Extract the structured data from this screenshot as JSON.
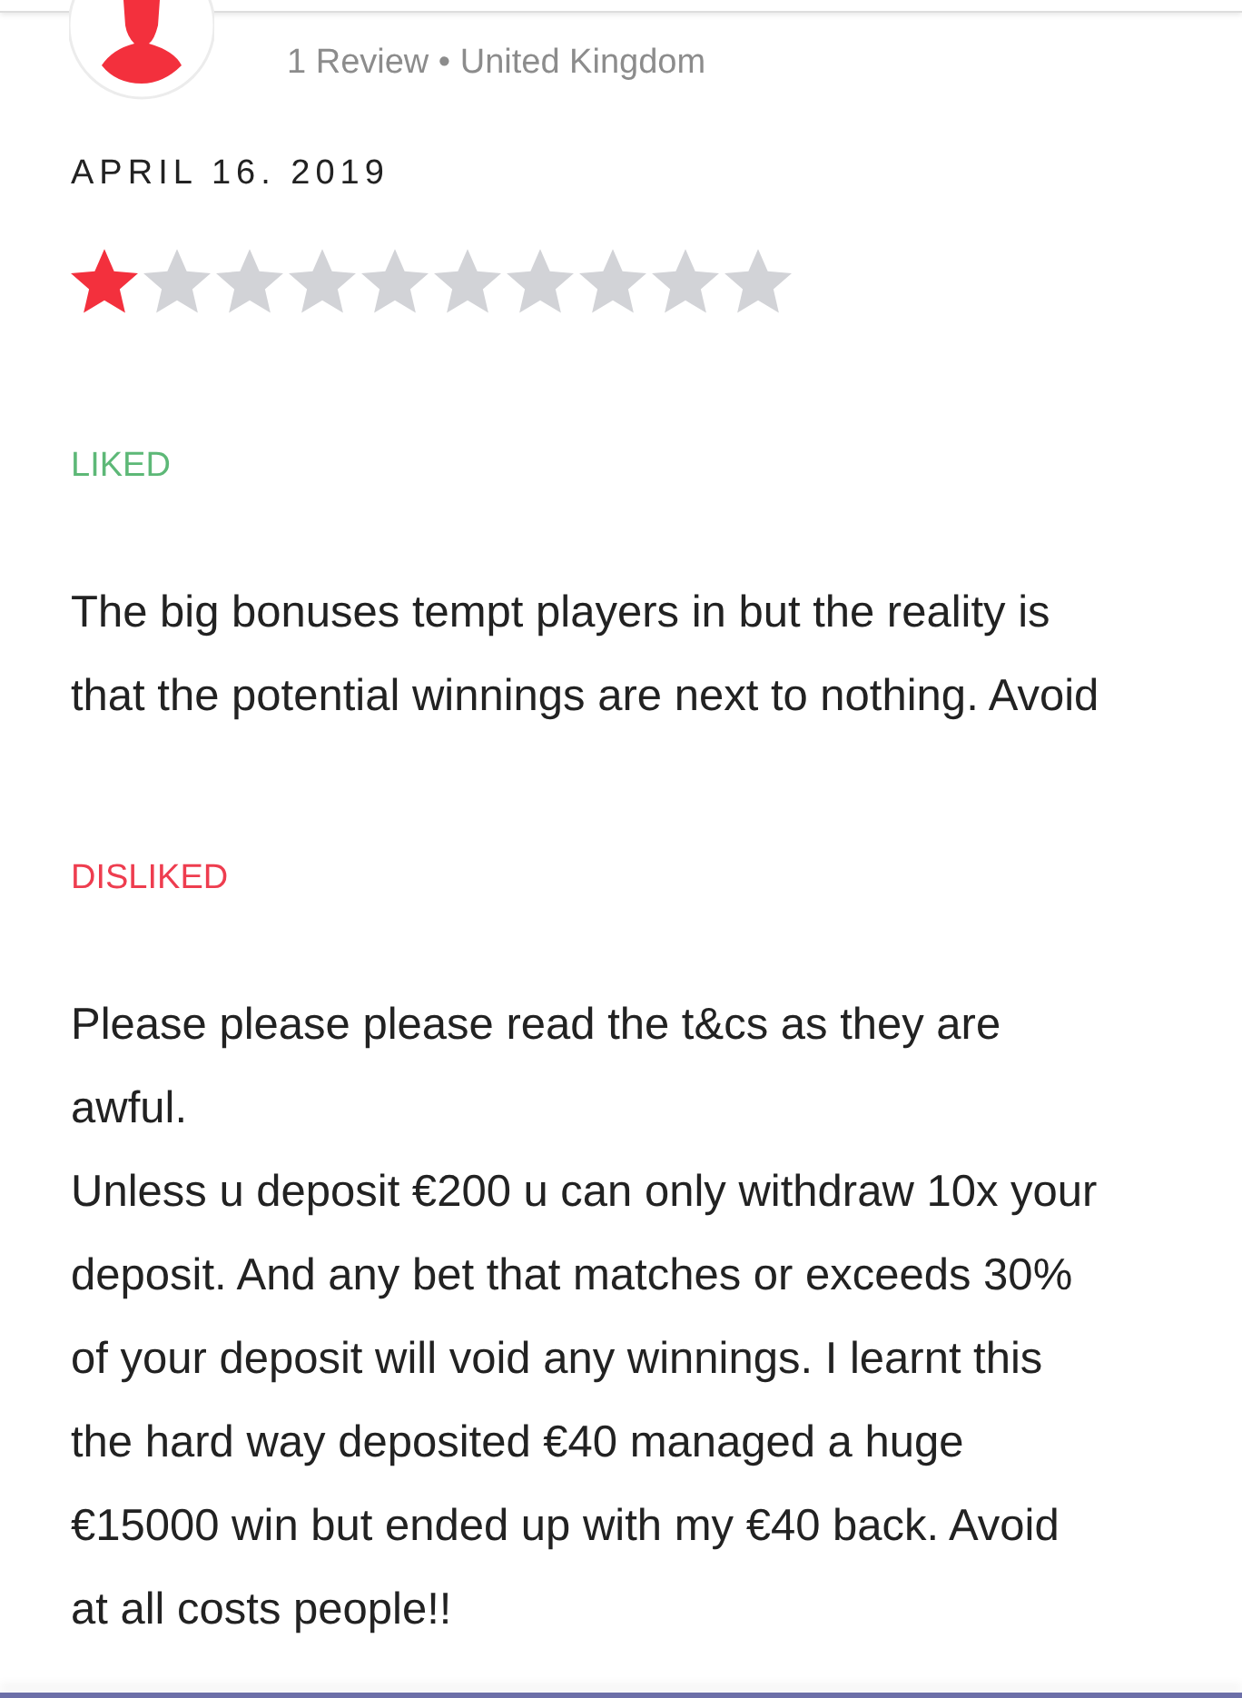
{
  "reviewer": {
    "meta": "1 Review • United Kingdom"
  },
  "review": {
    "date": "APRIL 16. 2019",
    "stars": 1,
    "liked": {
      "label": "LIKED",
      "text": "The big bonuses tempt players in but the reality is\nthat the potential winnings are next to nothing. Avoid"
    },
    "disliked": {
      "label": "DISLIKED",
      "text": "Please please please read the t&cs as they are\nawful.\nUnless u deposit €200 u can only withdraw 10x your\ndeposit. And any bet that matches or exceeds 30%\nof your deposit will void any winnings. I learnt this\nthe hard way deposited €40 managed a huge\n€15000 win but ended up with my €40 back. Avoid\nat all costs people!!"
    }
  }
}
